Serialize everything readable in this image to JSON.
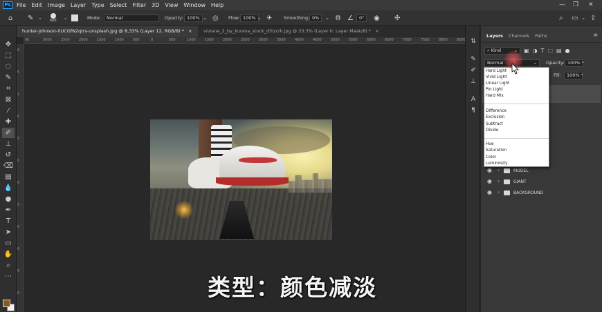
{
  "menubar": {
    "logo": "Ps",
    "items": [
      "File",
      "Edit",
      "Image",
      "Layer",
      "Type",
      "Select",
      "Filter",
      "3D",
      "View",
      "Window",
      "Help"
    ]
  },
  "options_bar": {
    "brush_size": "600",
    "mode_label": "Mode:",
    "mode_value": "Normal",
    "opacity_label": "Opacity:",
    "opacity_value": "100%",
    "flow_label": "Flow:",
    "flow_value": "100%",
    "smoothing_label": "Smoothing:",
    "smoothing_value": "0%",
    "angle_value": "0°"
  },
  "doc_tabs": [
    {
      "label": "hunter-johnson-0UCGfN2qtrs-unsplash.jpg @ 8,33% (Layer 12, RGB/8) *",
      "close": "×"
    },
    {
      "label": "viviane_2_by_kuoma_stock_d5izcrk.jpg @ 33,3% (Layer 0, Layer Mask/8) *",
      "close": "×"
    }
  ],
  "ruler_h": [
    "00",
    "3000",
    "2500",
    "2000",
    "1500",
    "1000",
    "500",
    "0",
    "500",
    "1000",
    "1500",
    "2000",
    "2500",
    "3000",
    "3500",
    "4000",
    "4500",
    "5000",
    "5500",
    "6000",
    "6500",
    "7000",
    "7500",
    "8000",
    "8500"
  ],
  "ruler_v": [
    "0",
    "5",
    "1",
    "0",
    "5",
    "0",
    "0",
    "5",
    "0",
    "0",
    "5",
    "0"
  ],
  "subtitle": "类型：颜色减淡",
  "layers_panel": {
    "tabs": [
      "Layers",
      "Channels",
      "Paths"
    ],
    "filter_kind": "Kind",
    "blend_mode": "Normal",
    "opacity_label": "Opacity:",
    "opacity_value": "100%",
    "fill_label": "Fill:",
    "fill_value": "100%",
    "layers": [
      {
        "name": "MODEL"
      },
      {
        "name": "GIANT"
      },
      {
        "name": "BACKGROUND"
      }
    ]
  },
  "blend_dropdown": {
    "group1": [
      "Hard Light",
      "Vivid Light",
      "Linear Light",
      "Pin Light",
      "Hard Mix"
    ],
    "group2": [
      "Difference",
      "Exclusion",
      "Subtract",
      "Divide"
    ],
    "group3": [
      "Hue",
      "Saturation",
      "Color",
      "Luminosity"
    ]
  }
}
